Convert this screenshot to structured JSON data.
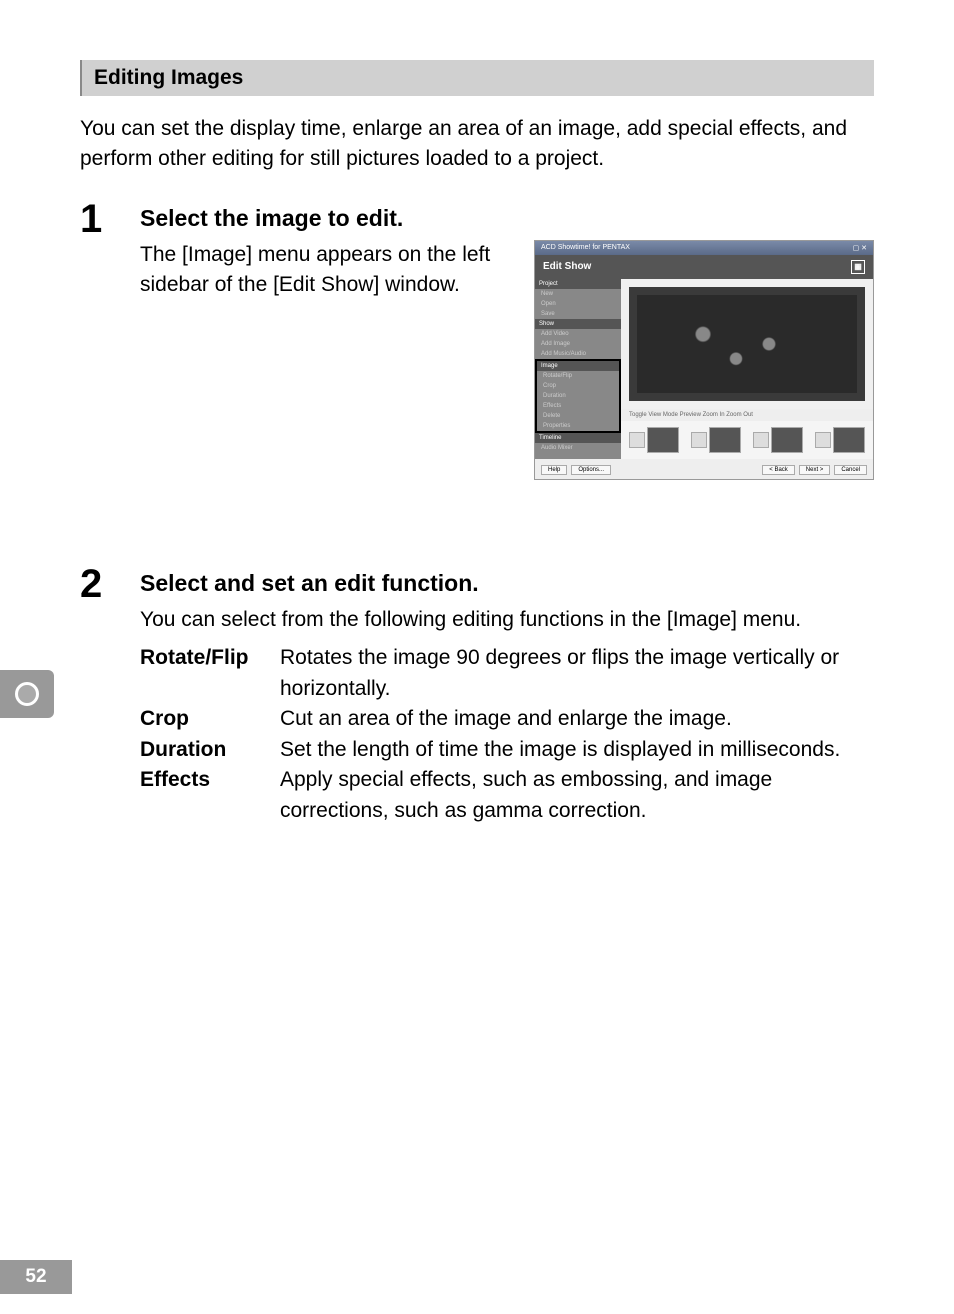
{
  "section_heading": "Editing Images",
  "intro": "You can set the display time, enlarge an area of an image, add special effects, and perform other editing for still pictures loaded to a project.",
  "steps": [
    {
      "num": "1",
      "title": "Select the image to edit.",
      "text": "The [Image] menu appears on the left sidebar of the [Edit Show] window."
    },
    {
      "num": "2",
      "title": "Select and set an edit function.",
      "text": "You can select from the following editing functions in the [Image] menu."
    }
  ],
  "functions": [
    {
      "name": "Rotate/Flip",
      "desc": "Rotates the image 90 degrees or flips the image vertically or horizontally."
    },
    {
      "name": "Crop",
      "desc": "Cut an area of the image and enlarge the image."
    },
    {
      "name": "Duration",
      "desc": "Set the length of time the image is displayed in milliseconds."
    },
    {
      "name": "Effects",
      "desc": "Apply special effects, such as embossing, and image corrections, such as gamma correction."
    }
  ],
  "screenshot": {
    "titlebar": "ACD Showtime! for PENTAX",
    "heading": "Edit Show",
    "sidebar": {
      "project_header": "Project",
      "project_items": [
        "New",
        "Open",
        "Save"
      ],
      "show_header": "Show",
      "show_items": [
        "Add Video",
        "Add Image",
        "Add Music/Audio"
      ],
      "image_header": "Image",
      "image_items": [
        "Rotate/Flip",
        "Crop",
        "Duration",
        "Effects",
        "Delete",
        "Properties"
      ],
      "timeline_header": "Timeline",
      "timeline_items": [
        "Audio Mixer"
      ]
    },
    "toolbar": "Toggle View Mode    Preview    Zoom In    Zoom Out",
    "footer_left": [
      "Help",
      "Options..."
    ],
    "footer_right": [
      "< Back",
      "Next >",
      "Cancel"
    ]
  },
  "page_number": "52"
}
